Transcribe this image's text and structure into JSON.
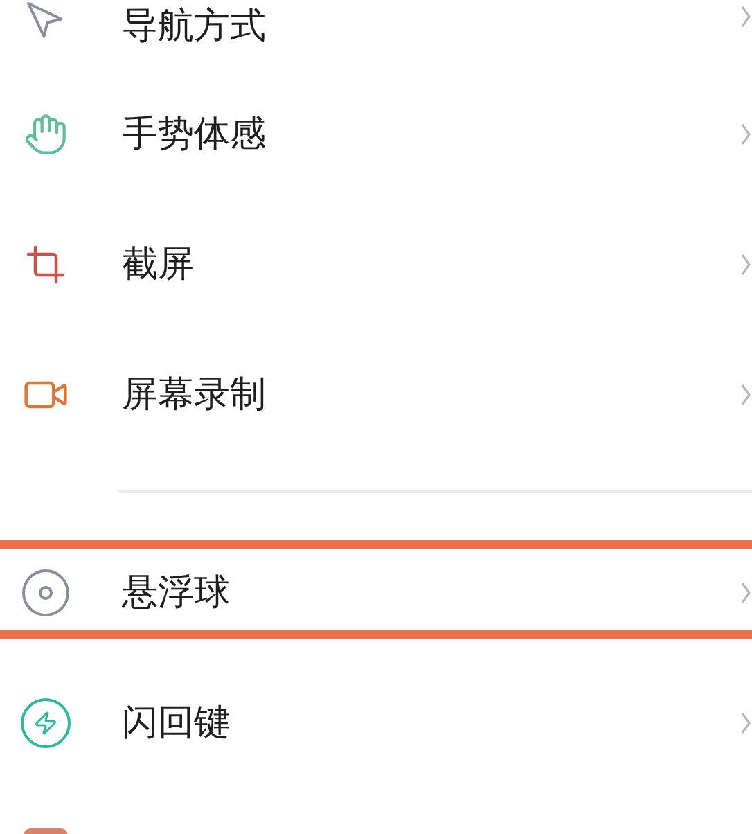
{
  "sections": [
    {
      "items": [
        {
          "label": "导航方式",
          "highlighted": false
        },
        {
          "label": "手势体感",
          "highlighted": false
        },
        {
          "label": "截屏",
          "highlighted": false
        },
        {
          "label": "屏幕录制",
          "highlighted": false
        }
      ]
    },
    {
      "items": [
        {
          "label": "悬浮球",
          "highlighted": true
        },
        {
          "label": "闪回键",
          "highlighted": false
        },
        {
          "highlighted": false
        }
      ]
    }
  ]
}
